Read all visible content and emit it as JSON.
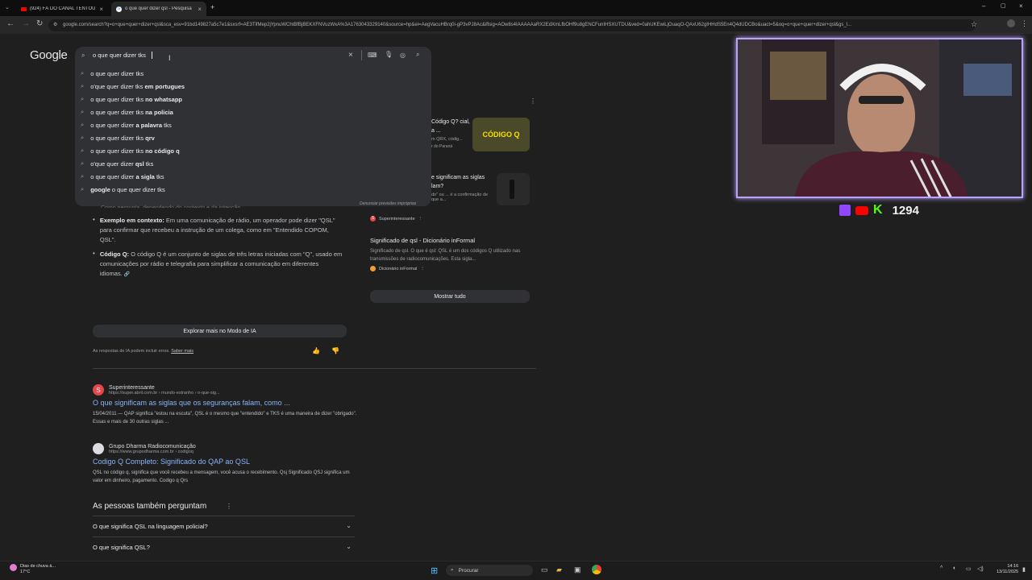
{
  "tabs": [
    {
      "label": "(924) FÃ DO CANAL TENTOU F"
    },
    {
      "label": "o que quer dizer qsl - Pesquisa"
    }
  ],
  "url": "google.com/search?q=o+que+quer+dizer+qsl&sca_esv=91bd149827a5c7e1&sxsrf=AE3TifMep2jYpnuWChtBfBjBEKXFNVuzWxA%3A1763043329140&source=hp&ei=AegVacuHBrq0i-gP3vPJ8Ac&iflsig=AOw8s4IAAAAAaRX2EdXmLfbOHf9u8gENCFunIHSXUTDU&ved=0ahUKEwiLjOuaqO-QAxU62gIHHdS5En4Q4dUDCBo&uact=5&oq=o+que+quer+dizer+qsl&gs_l...",
  "logo": "Google",
  "search_value": "o que quer dizer tks",
  "suggestions": [
    {
      "pre": "o que quer dizer tks",
      "bold": ""
    },
    {
      "pre": "o'que quer dizer tks ",
      "bold": "em portugues"
    },
    {
      "pre": "o que quer dizer tks ",
      "bold": "no whatsapp"
    },
    {
      "pre": "o que quer dizer tks ",
      "bold": "na policia"
    },
    {
      "pre": "o que quer dizer ",
      "bold": "a palavra",
      "post": " tks"
    },
    {
      "pre": "o que quer dizer tks ",
      "bold": "qrv"
    },
    {
      "pre": "o que quer dizer tks ",
      "bold": "no código q"
    },
    {
      "pre": "o'que quer dizer ",
      "bold": "qsl",
      "post": " tks"
    },
    {
      "pre": "o que quer dizer ",
      "bold": "a sigla",
      "post": " tks"
    },
    {
      "pre": "",
      "bold": "google",
      "post": " o que quer dizer tks"
    }
  ],
  "report_text": "Denunciar previsões impróprias",
  "ai": {
    "partial_line": "Como pergunta, dependendo do contexto e da intenção.",
    "bullets": [
      {
        "head": "Exemplo em contexto:",
        "text": " Em uma comunicação de rádio, um operador pode dizer \"QSL\" para confirmar que recebeu a instrução de um colega, como em \"Entendido COPOM, QSL\"."
      },
      {
        "head": "Código Q:",
        "text": " O código Q é um conjunto de siglas de três letras iniciadas com \"Q\", usado em comunicações por rádio e telegrafia para simplificar a comunicação em diferentes idiomas."
      }
    ],
    "explore_btn": "Explorar mais no Modo de IA",
    "disclaimer": "As respostas de IA podem incluir erros.",
    "learn_more": "Saber mais"
  },
  "side_cards": [
    {
      "title": "Código Q? cial, a ...",
      "snippet": "m QRX, códig...",
      "source": "r do Paraná",
      "thumb": "CÓDIGO Q"
    },
    {
      "title": "e significam as siglas lam?",
      "snippet": "do\" ou ... é a confirmação de que a...",
      "source": "Superinteressante"
    },
    {
      "title": "Significado de qsl - Dicionário inFormal",
      "snippet": "Significado de qsl. O que é qsl: QSL é um dos códigos Q utilizado nas transmissões de radiocomunicações. Esta sigla...",
      "source": "Dicionário inFormal"
    }
  ],
  "show_all": "Mostrar tudo",
  "results": [
    {
      "site": "Superinteressante",
      "url": "https://super.abril.com.br › mundo-estranho › o-que-sig...",
      "title": "O que significam as siglas que os seguranças falam, como ...",
      "snippet": "15/04/2011 — QAP significa \"estou na escuta\", QSL é o mesmo que \"entendido\" e TKS é uma maneira de dizer \"obrigado\". Essas e mais de 30 outras siglas ..."
    },
    {
      "site": "Grupo Dharma Radiocomunicação",
      "url": "https://www.grupodharma.com.br › codigoq",
      "title": "Codigo Q Completo: Significado do QAP ao QSL",
      "snippet": "QSL no código q, significa que você recebeu a mensagem, você acusa o recebimento. Qsj Significado QSJ significa um valor em dinheiro, pagamento. Codigo q Qrs"
    }
  ],
  "paa": {
    "heading": "As pessoas também perguntam",
    "questions": [
      "O que significa QSL na linguagem policial?",
      "O que significa QSL?"
    ]
  },
  "overlay": {
    "count": "1294"
  },
  "taskbar": {
    "weather_title": "Dias de chuva à...",
    "weather_temp": "17°C",
    "search_label": "Procurar",
    "time": "14:16",
    "date": "13/11/2025"
  },
  "colors": {
    "accent": "#8ab4f8",
    "cam_border": "#b9a3ff",
    "twitch": "#9146ff",
    "youtube": "#ff0000",
    "kick": "#53fc18"
  }
}
